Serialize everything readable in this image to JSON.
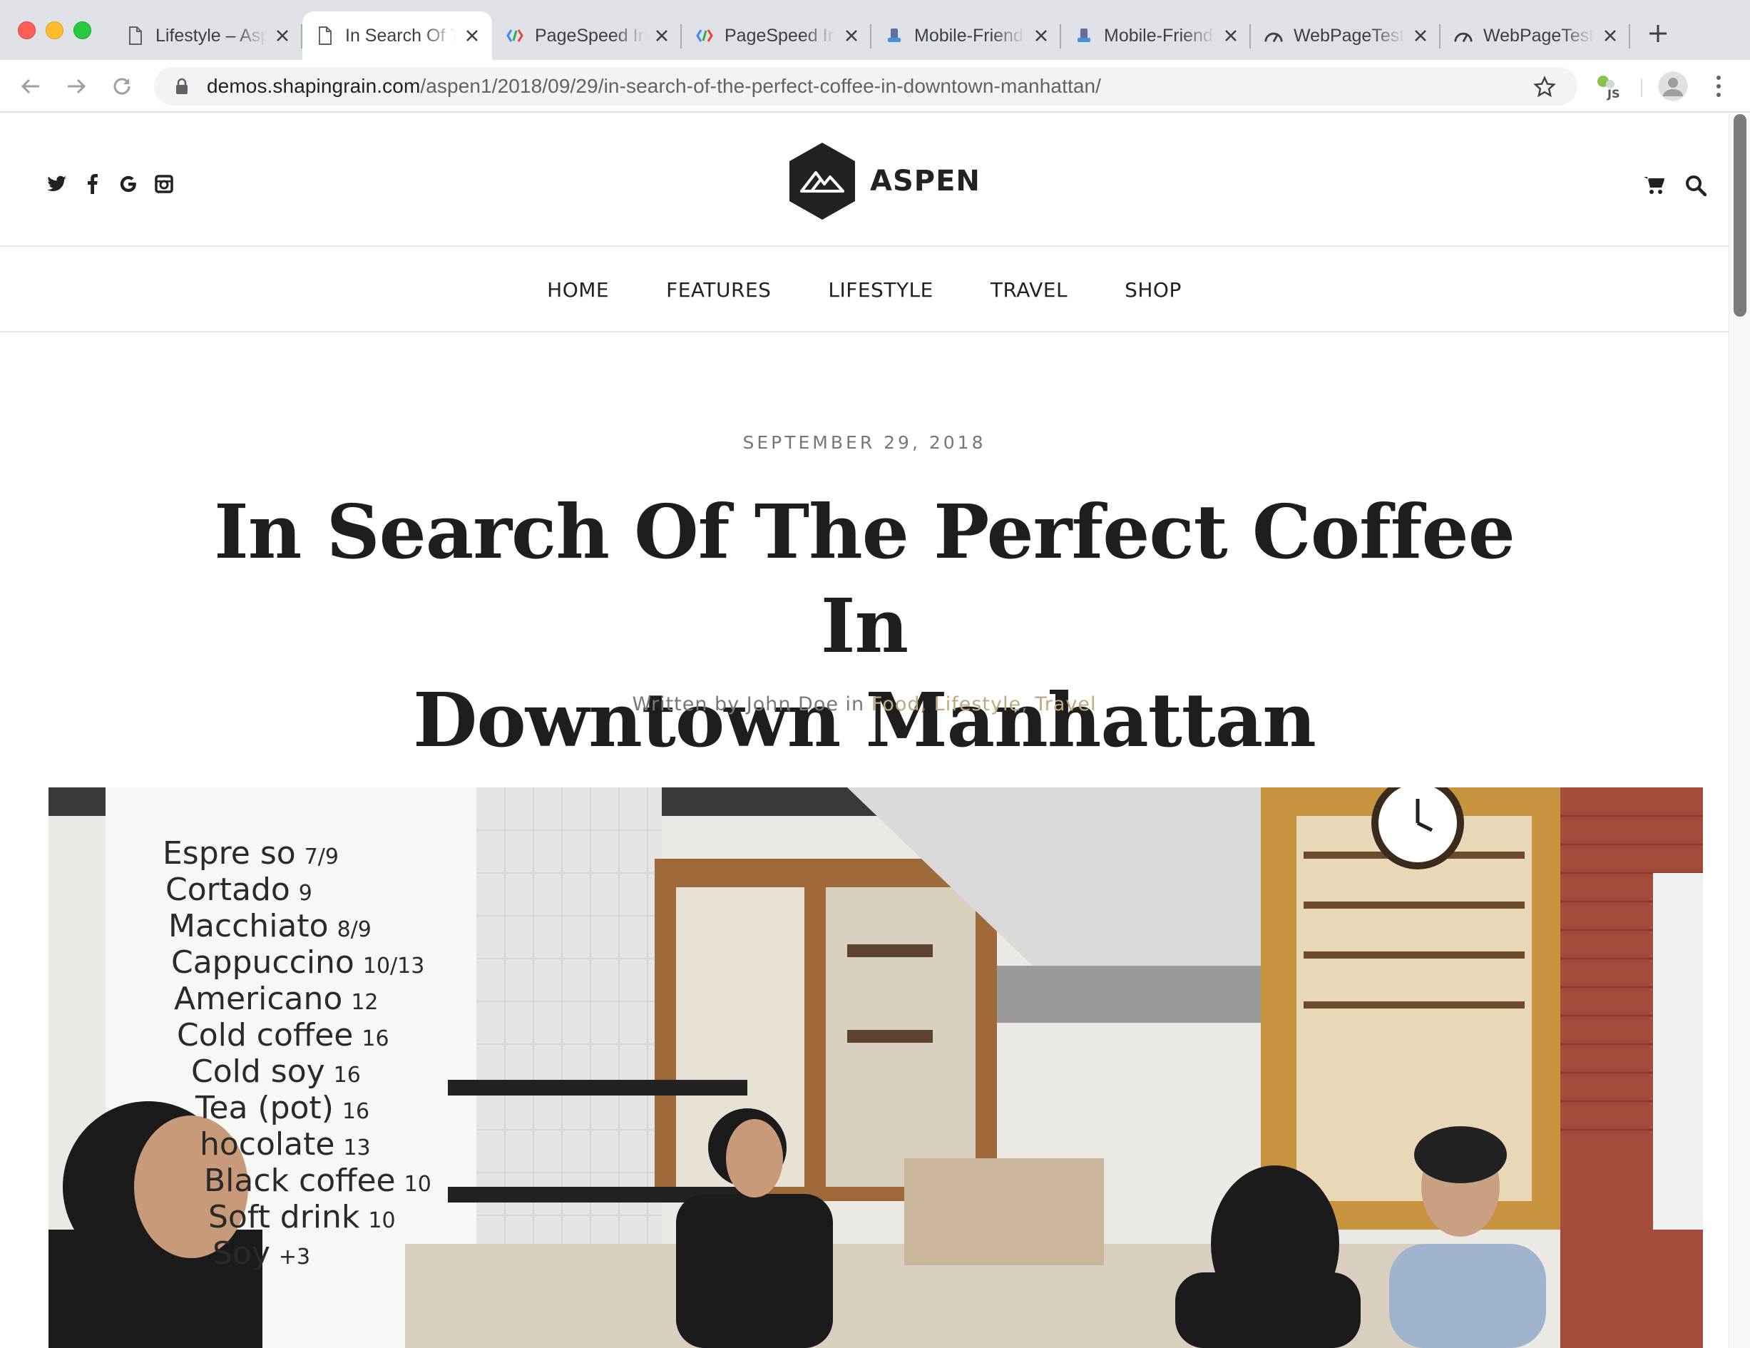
{
  "browser": {
    "tabs": [
      {
        "title": "Lifestyle – Aspen",
        "icon": "page-icon",
        "active": false
      },
      {
        "title": "In Search Of The Perfect Coffee",
        "icon": "page-icon",
        "active": true
      },
      {
        "title": "PageSpeed Insights",
        "icon": "pagespeed-icon",
        "active": false
      },
      {
        "title": "PageSpeed Insights",
        "icon": "pagespeed-icon",
        "active": false
      },
      {
        "title": "Mobile-Friendly Test",
        "icon": "mobile-friendly-icon",
        "active": false
      },
      {
        "title": "Mobile-Friendly Test",
        "icon": "mobile-friendly-icon",
        "active": false
      },
      {
        "title": "WebPageTest",
        "icon": "webpagetest-icon",
        "active": false
      },
      {
        "title": "WebPageTest",
        "icon": "webpagetest-icon",
        "active": false
      }
    ],
    "url_host": "demos.shapingrain.com",
    "url_path": "/aspen1/2018/09/29/in-search-of-the-perfect-coffee-in-downtown-manhattan/"
  },
  "site": {
    "logo_text": "ASPEN",
    "social_icons": [
      "twitter-icon",
      "facebook-icon",
      "google-icon",
      "instagram-icon"
    ],
    "nav": [
      "HOME",
      "FEATURES",
      "LIFESTYLE",
      "TRAVEL",
      "SHOP"
    ]
  },
  "post": {
    "date": "SEPTEMBER 29, 2018",
    "title_line1": "In Search Of The Perfect Coffee In",
    "title_line2": "Downtown Manhattan",
    "meta_prefix": "Written by John Doe in ",
    "categories": [
      "Food",
      "Lifestyle",
      "Travel"
    ],
    "image_menu_board": [
      {
        "item": "Espre so",
        "price": "7/9"
      },
      {
        "item": "Cortado",
        "price": "9"
      },
      {
        "item": "Macchiato",
        "price": "8/9"
      },
      {
        "item": "Cappuccino",
        "price": "10/13"
      },
      {
        "item": "Americano",
        "price": "12"
      },
      {
        "item": "Cold coffee",
        "price": "16"
      },
      {
        "item": "Cold soy",
        "price": "16"
      },
      {
        "item": "Tea (pot)",
        "price": "16"
      },
      {
        "item": "hocolate",
        "price": "13"
      },
      {
        "item": "Black coffee",
        "price": "10"
      },
      {
        "item": "Soft drink",
        "price": "10"
      },
      {
        "item": "Soy",
        "price": "+3"
      }
    ]
  },
  "colors": {
    "accent_category": "#bfa97f",
    "tabbar_bg": "#dee1e6",
    "text_dark": "#1e1e1e"
  }
}
